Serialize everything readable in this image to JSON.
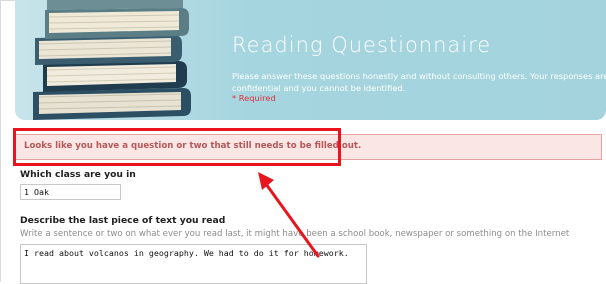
{
  "header": {
    "title": "Reading Questionnaire",
    "description": "Please answer these questions honestly and without consulting others. Your responses are confidential and you cannot be identified.",
    "required_note": "* Required"
  },
  "error_banner": {
    "message": "Looks like you have a question or two that still needs to be filled out."
  },
  "questions": [
    {
      "title": "Which class are you in",
      "value": "1 Oak"
    },
    {
      "title": "Describe the last piece of text you read",
      "help": "Write a sentence or two on what ever you read last, it might have been a school book, newspaper or something on the Internet",
      "value": "I read about volcanos in geography.  We had to do it for homework."
    }
  ],
  "colors": {
    "header_bg": "#a4d3dd",
    "error_bg": "#fbe6e6",
    "error_text": "#b75757",
    "highlight": "#e8151f",
    "required": "#e0303a"
  }
}
